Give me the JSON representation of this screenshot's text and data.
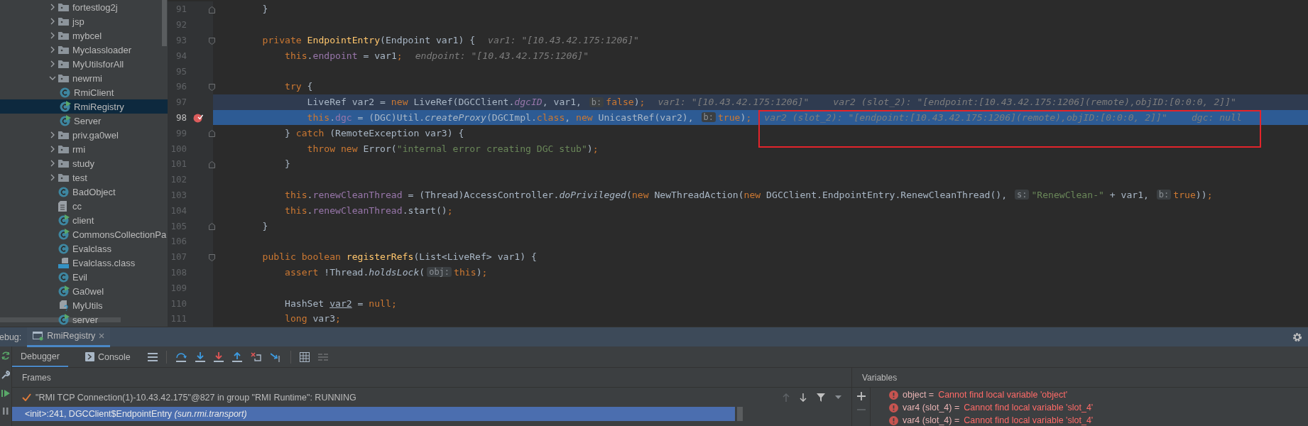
{
  "project_tree": {
    "items": [
      {
        "label": "fortestlog2j",
        "kind": "folder",
        "expanded": false,
        "selected": false
      },
      {
        "label": "jsp",
        "kind": "folder",
        "expanded": false,
        "selected": false
      },
      {
        "label": "mybcel",
        "kind": "folder",
        "expanded": false,
        "selected": false
      },
      {
        "label": "Myclassloader",
        "kind": "folder",
        "expanded": false,
        "selected": false
      },
      {
        "label": "MyUtilsforAll",
        "kind": "folder",
        "expanded": false,
        "selected": false
      },
      {
        "label": "newrmi",
        "kind": "folder",
        "expanded": true,
        "selected": false,
        "children": [
          {
            "label": "RmiClient",
            "kind": "class",
            "selected": false
          },
          {
            "label": "RmiRegistry",
            "kind": "runnable_class",
            "selected": true
          },
          {
            "label": "Server",
            "kind": "runnable_class",
            "selected": false
          }
        ]
      },
      {
        "label": "priv.ga0wel",
        "kind": "folder",
        "expanded": false,
        "selected": false
      },
      {
        "label": "rmi",
        "kind": "folder",
        "expanded": false,
        "selected": false
      },
      {
        "label": "study",
        "kind": "folder",
        "expanded": false,
        "selected": false
      },
      {
        "label": "test",
        "kind": "folder",
        "expanded": false,
        "selected": false
      },
      {
        "label": "BadObject",
        "kind": "class",
        "selected": false
      },
      {
        "label": "cc",
        "kind": "text_file",
        "selected": false
      },
      {
        "label": "client",
        "kind": "runnable_class",
        "selected": false
      },
      {
        "label": "CommonsCollectionPa",
        "kind": "runnable_class",
        "selected": false
      },
      {
        "label": "Evalclass",
        "kind": "class",
        "selected": false
      },
      {
        "label": "Evalclass.class",
        "kind": "binary_file",
        "selected": false
      },
      {
        "label": "Evil",
        "kind": "class",
        "selected": false
      },
      {
        "label": "Ga0wel",
        "kind": "runnable_class",
        "selected": false
      },
      {
        "label": "MyUtils",
        "kind": "unknown_file",
        "selected": false
      },
      {
        "label": "server",
        "kind": "runnable_class",
        "selected": false
      }
    ]
  },
  "editor": {
    "annotation": {
      "kind": "rectangle"
    },
    "lines": [
      {
        "number": "91",
        "fold_end": true,
        "tokens": [
          {
            "kind": "plain",
            "text": "    }"
          }
        ]
      },
      {
        "number": "92"
      },
      {
        "number": "93",
        "fold_start": true,
        "tokens": [
          {
            "kind": "keyword",
            "text": "    private "
          },
          {
            "kind": "declaration",
            "text": "EndpointEntry"
          },
          {
            "kind": "plain",
            "text": "(Endpoint var1) {"
          },
          {
            "kind": "value_hint",
            "text": "var1: \"[10.43.42.175:1206]\""
          }
        ]
      },
      {
        "number": "94",
        "tokens": [
          {
            "kind": "keyword",
            "text": "        this"
          },
          {
            "kind": "plain",
            "text": "."
          },
          {
            "kind": "field",
            "text": "endpoint"
          },
          {
            "kind": "plain",
            "text": " = var1"
          },
          {
            "kind": "keyword",
            "text": ";"
          },
          {
            "kind": "value_hint",
            "text": "endpoint: \"[10.43.42.175:1206]\""
          }
        ]
      },
      {
        "number": "95"
      },
      {
        "number": "96",
        "fold_start": true,
        "tokens": [
          {
            "kind": "keyword",
            "text": "        try "
          },
          {
            "kind": "plain",
            "text": "{"
          }
        ]
      },
      {
        "number": "97",
        "current_line": true,
        "tokens": [
          {
            "kind": "plain",
            "text": "            LiveRef var2 = "
          },
          {
            "kind": "keyword",
            "text": "new "
          },
          {
            "kind": "plain",
            "text": "LiveRef(DGCClient."
          },
          {
            "kind": "static_field",
            "text": "dgcID"
          },
          {
            "kind": "plain",
            "text": ", var1, "
          },
          {
            "kind": "param_hint",
            "text": "b:"
          },
          {
            "kind": "keyword",
            "text": "false"
          },
          {
            "kind": "plain",
            "text": ")"
          },
          {
            "kind": "keyword",
            "text": ";"
          },
          {
            "kind": "value_hint",
            "text": "var1: \"[10.43.42.175:1206]\""
          },
          {
            "kind": "value_hint",
            "text": "var2 (slot_2): \"[endpoint:[10.43.42.175:1206](remote),objID:[0:0:0, 2]]\""
          }
        ]
      },
      {
        "number": "98",
        "execution_point": true,
        "breakpoint": true,
        "tokens": [
          {
            "kind": "keyword",
            "text": "            this"
          },
          {
            "kind": "plain",
            "text": "."
          },
          {
            "kind": "field",
            "text": "dgc"
          },
          {
            "kind": "plain",
            "text": " = (DGC)Util."
          },
          {
            "kind": "static_call",
            "text": "createProxy"
          },
          {
            "kind": "plain",
            "text": "(DGCImpl."
          },
          {
            "kind": "keyword",
            "text": "class"
          },
          {
            "kind": "plain",
            "text": ", "
          },
          {
            "kind": "keyword",
            "text": "new "
          },
          {
            "kind": "plain",
            "text": "UnicastRef(var2), "
          },
          {
            "kind": "param_hint",
            "text": "b:"
          },
          {
            "kind": "keyword",
            "text": "true"
          },
          {
            "kind": "plain",
            "text": ")"
          },
          {
            "kind": "keyword",
            "text": ";"
          },
          {
            "kind": "value_hint",
            "text": "var2 (slot_2): \"[endpoint:[10.43.42.175:1206](remote),objID:[0:0:0, 2]]\""
          },
          {
            "kind": "value_hint",
            "text": "dgc: null"
          }
        ]
      },
      {
        "number": "99",
        "fold_end": true,
        "tokens": [
          {
            "kind": "plain",
            "text": "        } "
          },
          {
            "kind": "keyword",
            "text": "catch "
          },
          {
            "kind": "plain",
            "text": "(RemoteException var3) {"
          }
        ]
      },
      {
        "number": "100",
        "tokens": [
          {
            "kind": "keyword",
            "text": "            throw new "
          },
          {
            "kind": "plain",
            "text": "Error("
          },
          {
            "kind": "string",
            "text": "\"internal error creating DGC stub\""
          },
          {
            "kind": "plain",
            "text": ")"
          },
          {
            "kind": "keyword",
            "text": ";"
          }
        ]
      },
      {
        "number": "101",
        "fold_end": true,
        "tokens": [
          {
            "kind": "plain",
            "text": "        }"
          }
        ]
      },
      {
        "number": "102"
      },
      {
        "number": "103",
        "tokens": [
          {
            "kind": "keyword",
            "text": "        this"
          },
          {
            "kind": "plain",
            "text": "."
          },
          {
            "kind": "field",
            "text": "renewCleanThread"
          },
          {
            "kind": "plain",
            "text": " = (Thread)AccessController."
          },
          {
            "kind": "static_call",
            "text": "doPrivileged"
          },
          {
            "kind": "plain",
            "text": "("
          },
          {
            "kind": "keyword",
            "text": "new "
          },
          {
            "kind": "plain",
            "text": "NewThreadAction("
          },
          {
            "kind": "keyword",
            "text": "new "
          },
          {
            "kind": "plain",
            "text": "DGCClient.EndpointEntry.RenewCleanThread(), "
          },
          {
            "kind": "param_hint",
            "text": "s:"
          },
          {
            "kind": "string",
            "text": "\"RenewClean-\""
          },
          {
            "kind": "plain",
            "text": " + var1, "
          },
          {
            "kind": "param_hint",
            "text": "b:"
          },
          {
            "kind": "keyword",
            "text": "true"
          },
          {
            "kind": "plain",
            "text": "))"
          },
          {
            "kind": "keyword",
            "text": ";"
          }
        ]
      },
      {
        "number": "104",
        "tokens": [
          {
            "kind": "keyword",
            "text": "        this"
          },
          {
            "kind": "plain",
            "text": "."
          },
          {
            "kind": "field",
            "text": "renewCleanThread"
          },
          {
            "kind": "plain",
            "text": ".start()"
          },
          {
            "kind": "keyword",
            "text": ";"
          }
        ]
      },
      {
        "number": "105",
        "fold_end": true,
        "tokens": [
          {
            "kind": "plain",
            "text": "    }"
          }
        ]
      },
      {
        "number": "106"
      },
      {
        "number": "107",
        "fold_start": true,
        "tokens": [
          {
            "kind": "keyword",
            "text": "    public boolean "
          },
          {
            "kind": "declaration",
            "text": "registerRefs"
          },
          {
            "kind": "plain",
            "text": "(List<LiveRef> var1) {"
          }
        ]
      },
      {
        "number": "108",
        "tokens": [
          {
            "kind": "keyword",
            "text": "        assert "
          },
          {
            "kind": "plain",
            "text": "!Thread."
          },
          {
            "kind": "static_call",
            "text": "holdsLock"
          },
          {
            "kind": "plain",
            "text": "("
          },
          {
            "kind": "param_hint",
            "text": "obj:"
          },
          {
            "kind": "keyword",
            "text": "this"
          },
          {
            "kind": "plain",
            "text": ")"
          },
          {
            "kind": "keyword",
            "text": ";"
          }
        ]
      },
      {
        "number": "109"
      },
      {
        "number": "110",
        "tokens": [
          {
            "kind": "plain",
            "text": "        HashSet "
          },
          {
            "kind": "underlined",
            "text": "var2"
          },
          {
            "kind": "plain",
            "text": " = "
          },
          {
            "kind": "keyword",
            "text": "null;"
          }
        ]
      },
      {
        "number": "111",
        "tokens": [
          {
            "kind": "keyword",
            "text": "        long "
          },
          {
            "kind": "plain",
            "text": "var3"
          },
          {
            "kind": "keyword",
            "text": ";"
          }
        ]
      }
    ]
  },
  "debug": {
    "label": "ebug:",
    "tabs": [
      {
        "label": "RmiRegistry",
        "selected": true
      }
    ],
    "subtabs": [
      {
        "label": "Debugger",
        "selected": true
      },
      {
        "label": "Console",
        "selected": false
      }
    ],
    "frames": {
      "title": "Frames",
      "thread": "\"RMI TCP Connection(1)-10.43.42.175\"@827 in group \"RMI Runtime\": RUNNING",
      "items": [
        {
          "text": "<init>:241, DGCClient$EndpointEntry *(sun.rmi.transport)*",
          "selected": true
        }
      ]
    },
    "variables": {
      "title": "Variables",
      "items": [
        {
          "kind": "error",
          "name": "object =",
          "value": "Cannot find local variable 'object'"
        },
        {
          "kind": "error",
          "name": "var4 (slot_4) =",
          "value": "Cannot find local variable 'slot_4'"
        },
        {
          "kind": "error",
          "name": "var4 (slot_4) =",
          "value": "Cannot find local variable 'slot_4'"
        }
      ]
    }
  }
}
